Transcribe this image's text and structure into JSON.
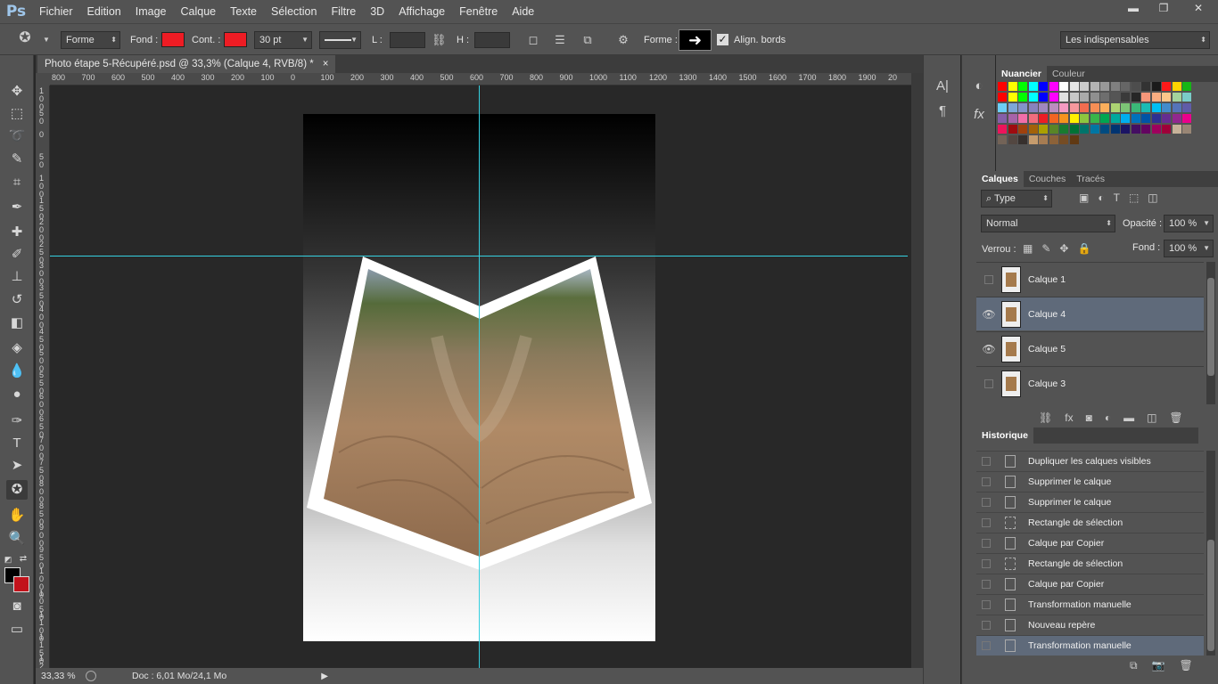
{
  "app": {
    "logo": "Ps"
  },
  "menu": [
    "Fichier",
    "Edition",
    "Image",
    "Calque",
    "Texte",
    "Sélection",
    "Filtre",
    "3D",
    "Affichage",
    "Fenêtre",
    "Aide"
  ],
  "window_controls": {
    "minimize": "▬",
    "restore": "❐",
    "close": "✕"
  },
  "options": {
    "mode": "Forme",
    "fill_label": "Fond :",
    "stroke_label": "Cont. :",
    "stroke_width": "30 pt",
    "w_label": "L :",
    "h_label": "H :",
    "shape_label": "Forme :",
    "align_label": "Align. bords",
    "workspace": "Les indispensables",
    "fill_color": "#ee1c24",
    "stroke_color": "#ee1c24"
  },
  "document": {
    "tab_title": "Photo étape 5-Récupéré.psd @ 33,3% (Calque 4, RVB/8) *",
    "close": "×",
    "ruler_h": [
      "800",
      "700",
      "600",
      "500",
      "400",
      "300",
      "200",
      "100",
      "0",
      "100",
      "200",
      "300",
      "400",
      "500",
      "600",
      "700",
      "800",
      "900",
      "1000",
      "1100",
      "1200",
      "1300",
      "1400",
      "1500",
      "1600",
      "1700",
      "1800",
      "1900",
      "20"
    ],
    "ruler_v": [
      "1 0 0",
      "5 0",
      "0",
      "5 0",
      "1 0 0",
      "1 5 0",
      "2 0 0",
      "2 5 0",
      "3 0 0",
      "3 5 0",
      "4 0 0",
      "4 5 0",
      "5 0 0",
      "5 5 0",
      "6 0 0",
      "6 5 0",
      "7 0 0",
      "7 5 0",
      "8 0 0",
      "8 5 0",
      "9 0 0",
      "9 5 0",
      "1 0 0 0",
      "1 0 5 0",
      "1 1 0 0",
      "1 1 5 0",
      "1 2 0 0"
    ]
  },
  "status": {
    "zoom": "33,33 %",
    "doc": "Doc : 6,01 Mo/24,1 Mo"
  },
  "swatches": {
    "tabs": [
      "Nuancier",
      "Couleur"
    ],
    "colors": [
      "#ff0000",
      "#ffff00",
      "#00ff00",
      "#00ffff",
      "#0000ff",
      "#ff00ff",
      "#ffffff",
      "#e6e6e6",
      "#cccccc",
      "#b3b3b3",
      "#999999",
      "#808080",
      "#666666",
      "#4d4d4d",
      "#333333",
      "#1a1a1a",
      "#ff1a1a",
      "#ffd400",
      "#16b516",
      "#ff0000",
      "#ffff00",
      "#00ff00",
      "#00ffff",
      "#0000ff",
      "#ff00ff",
      "#e0e0e0",
      "#c8c8c8",
      "#aaaaaa",
      "#8f8f8f",
      "#6e6e6e",
      "#555555",
      "#3a3a3a",
      "#262626",
      "#f7977a",
      "#f9ad81",
      "#fdc68a",
      "#a3d39c",
      "#7accc8",
      "#6dcff6",
      "#7ea7d8",
      "#8493ca",
      "#8882be",
      "#a187be",
      "#bc8dbf",
      "#f49ac2",
      "#f6989d",
      "#f26c4f",
      "#f68e55",
      "#fbaf5c",
      "#acd372",
      "#7cc576",
      "#3bb878",
      "#1abbb4",
      "#00bff3",
      "#438ccb",
      "#5574b9",
      "#605ca8",
      "#855fa8",
      "#a763a8",
      "#f06ea9",
      "#f26d7d",
      "#ed1c24",
      "#f26522",
      "#f7941d",
      "#fff200",
      "#8dc63f",
      "#39b54a",
      "#00a651",
      "#00a99d",
      "#00aeef",
      "#0072bc",
      "#0054a6",
      "#2e3192",
      "#662d91",
      "#92278f",
      "#ec008c",
      "#ed145b",
      "#9e0b0f",
      "#a0410d",
      "#a36209",
      "#aba000",
      "#598527",
      "#197b30",
      "#007236",
      "#00746b",
      "#0076a3",
      "#004b80",
      "#003471",
      "#1b1464",
      "#440e62",
      "#630460",
      "#9e005d",
      "#9e0039",
      "#c7b299",
      "#998675",
      "#736357",
      "#534741",
      "#37302d",
      "#c69c6d",
      "#a67c52",
      "#8c6239",
      "#754c24",
      "#603913"
    ]
  },
  "layers": {
    "tabs": [
      "Calques",
      "Couches",
      "Tracés"
    ],
    "filter": "Type",
    "blend": "Normal",
    "opacity_label": "Opacité :",
    "opacity": "100 %",
    "lock_label": "Verrou :",
    "fill_label": "Fond :",
    "fill": "100 %",
    "items": [
      {
        "name": "Calque 1",
        "visible": false
      },
      {
        "name": "Calque 4",
        "visible": true
      },
      {
        "name": "Calque 5",
        "visible": true
      },
      {
        "name": "Calque 3",
        "visible": false
      }
    ]
  },
  "history": {
    "tab": "Historique",
    "items": [
      "Dupliquer les calques visibles",
      "Supprimer le calque",
      "Supprimer le calque",
      "Rectangle de sélection",
      "Calque par Copier",
      "Rectangle de sélection",
      "Calque par Copier",
      "Transformation manuelle",
      "Nouveau repère",
      "Transformation manuelle"
    ]
  }
}
